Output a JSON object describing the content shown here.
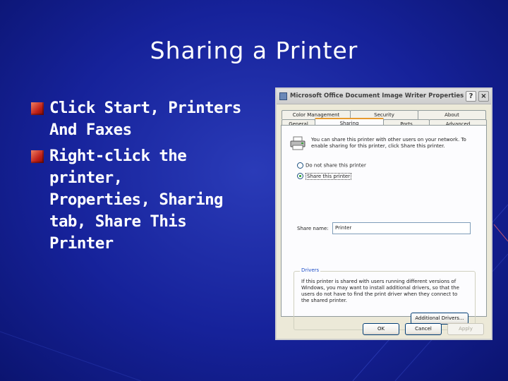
{
  "slide": {
    "title": "Sharing a Printer",
    "bullets": [
      {
        "lines": [
          "Click Start, Printers",
          "And Faxes"
        ]
      },
      {
        "lines": [
          "Right-click the printer,",
          "Properties, Sharing",
          "tab, Share This",
          "Printer"
        ]
      }
    ]
  },
  "dialog": {
    "title": "Microsoft Office Document Image Writer Properties",
    "help_glyph": "?",
    "close_glyph": "×",
    "tabs_back": [
      "Color Management",
      "Security",
      "About"
    ],
    "tabs_front": [
      "General",
      "Sharing",
      "Ports",
      "Advanced"
    ],
    "active_tab": "Sharing",
    "intro": "You can share this printer with other users on your network. To enable sharing for this printer, click Share this printer.",
    "radio_no_share": "Do not share this printer",
    "radio_share": "Share this printer",
    "share_name_label": "Share name:",
    "share_name_value": "Printer",
    "drivers_legend": "Drivers",
    "drivers_text": "If this printer is shared with users running different versions of Windows, you may want to install additional drivers, so that the users do not have to find the print driver when they connect to the shared printer.",
    "additional_drivers": "Additional Drivers...",
    "ok": "OK",
    "cancel": "Cancel",
    "apply": "Apply"
  },
  "colors": {
    "background": "#16229a",
    "bullet": "#c02018",
    "tab_highlight": "#e69a2e"
  }
}
